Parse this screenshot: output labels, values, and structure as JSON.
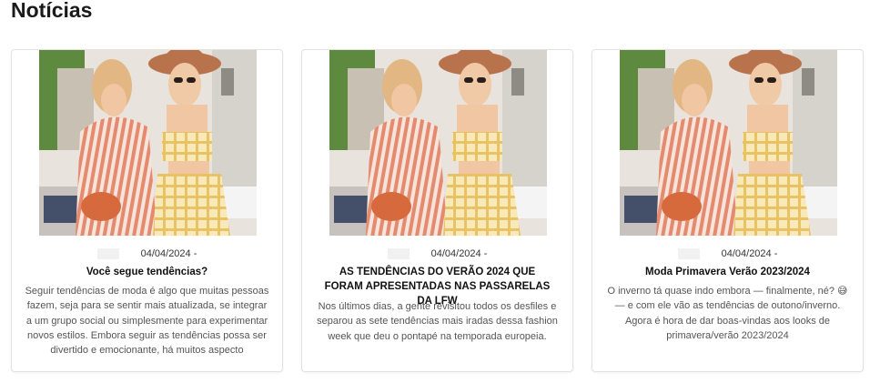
{
  "section": {
    "title": "Notícias"
  },
  "cards": [
    {
      "date": "04/04/2024 -",
      "title": "Você segue tendências?",
      "excerpt": "Seguir tendências de moda é algo que muitas pessoas fazem, seja para se sentir mais atualizada, se integrar a um grupo social ou simplesmente para experimentar novos estilos. Embora seguir as tendências possa ser divertido e emocionante, há muitos aspecto"
    },
    {
      "date": "04/04/2024 -",
      "title": "AS TENDÊNCIAS DO VERÃO 2024 QUE FORAM APRESENTADAS NAS PASSARELAS DA LFW",
      "excerpt": "Nos últimos dias, a gente revisitou todos os desfiles e separou as sete tendências mais iradas dessa fashion week que deu o pontapé na temporada europeia."
    },
    {
      "date": "04/04/2024 -",
      "title": "Moda Primavera Verão 2023/2024",
      "excerpt": "O inverno tá quase indo embora — finalmente, né? 😅 — e com ele vão as tendências de outono/inverno. Agora é hora de dar boas-vindas aos looks de primavera/verão 2023/2024"
    }
  ]
}
